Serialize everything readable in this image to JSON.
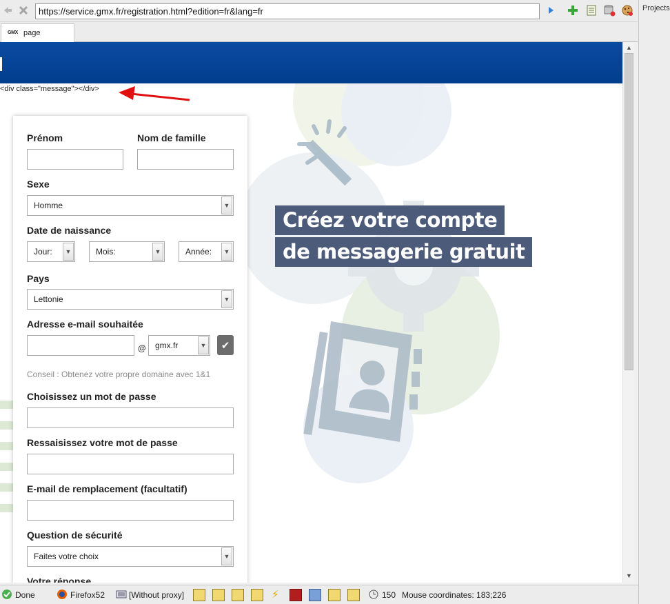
{
  "browser": {
    "url": "https://service.gmx.fr/registration.html?edition=fr&lang=fr",
    "tab_title": "page",
    "tab_favicon": "GMX",
    "projects_label": "Projects"
  },
  "page": {
    "debug_text": "<div class=\"message\"></div>",
    "headline_line1": "Créez votre compte",
    "headline_line2": "de messagerie gratuit",
    "colors": {
      "header": "#023e8d",
      "headline_bg": "#4d5b7a",
      "check_button": "#6c6c6c",
      "annotation_arrow": "#e01010"
    }
  },
  "form": {
    "first_name_label": "Prénom",
    "last_name_label": "Nom de famille",
    "gender_label": "Sexe",
    "gender_value": "Homme",
    "birthdate_label": "Date de naissance",
    "day_value": "Jour:",
    "month_value": "Mois:",
    "year_value": "Année:",
    "country_label": "Pays",
    "country_value": "Lettonie",
    "email_label": "Adresse e-mail souhaitée",
    "at_symbol": "@",
    "domain_value": "gmx.fr",
    "hint": "Conseil : Obtenez votre propre domaine avec 1&1",
    "password_label": "Choisissez un mot de passe",
    "password_confirm_label": "Ressaisissez votre mot de passe",
    "recovery_email_label": "E-mail de remplacement (facultatif)",
    "security_question_label": "Question de sécurité",
    "security_question_value": "Faites votre choix",
    "answer_label": "Votre réponse"
  },
  "statusbar": {
    "done": "Done",
    "browser": "Firefox52",
    "proxy": "[Without proxy]",
    "zoom": "150",
    "mouse": "Mouse coordinates: 183;226"
  }
}
